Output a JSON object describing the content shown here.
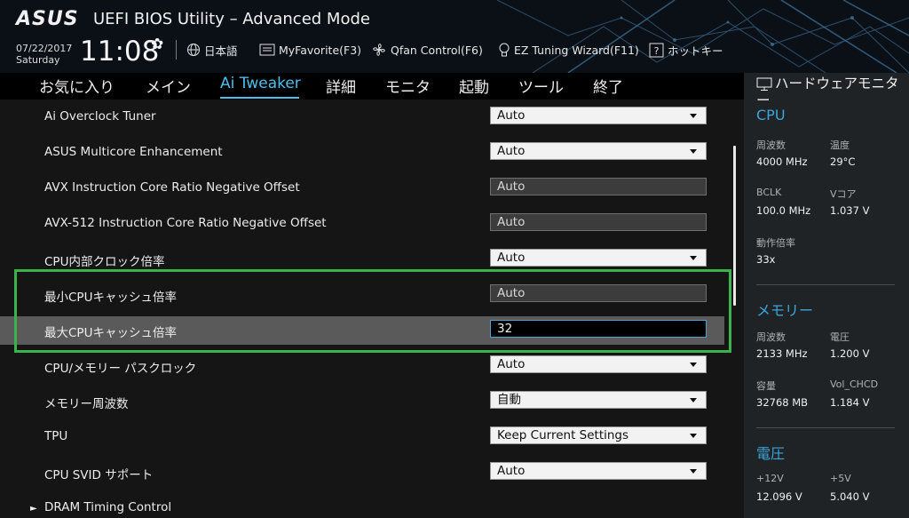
{
  "header": {
    "brand": "ASUS",
    "title": "UEFI BIOS Utility – Advanced Mode",
    "date": "07/22/2017",
    "day": "Saturday",
    "time": "11:08",
    "tools": [
      {
        "label": "日本語",
        "icon": "globe-icon"
      },
      {
        "label": "MyFavorite(F3)",
        "icon": "favorite-list-icon"
      },
      {
        "label": "Qfan Control(F6)",
        "icon": "fan-icon"
      },
      {
        "label": "EZ Tuning Wizard(F11)",
        "icon": "lightbulb-icon"
      },
      {
        "label": "ホットキー",
        "icon": "question-icon"
      }
    ]
  },
  "menu": {
    "items": [
      "お気に入り",
      "メイン",
      "Ai Tweaker",
      "詳細",
      "モニタ",
      "起動",
      "ツール",
      "終了"
    ],
    "active": "Ai Tweaker"
  },
  "settings": [
    {
      "label": "Ai Overclock Tuner",
      "value": "Auto",
      "type": "dropdown"
    },
    {
      "label": "ASUS Multicore Enhancement",
      "value": "Auto",
      "type": "dropdown"
    },
    {
      "label": "AVX Instruction Core Ratio Negative Offset",
      "value": "Auto",
      "type": "readonly"
    },
    {
      "label": "AVX-512 Instruction Core Ratio Negative Offset",
      "value": "Auto",
      "type": "readonly"
    },
    {
      "label": "CPU内部クロック倍率",
      "value": "Auto",
      "type": "dropdown"
    },
    {
      "label": "最小CPUキャッシュ倍率",
      "value": "Auto",
      "type": "readonly"
    },
    {
      "label": "最大CPUキャッシュ倍率",
      "value": "32",
      "type": "input",
      "selected": true
    },
    {
      "label": "CPU/メモリー パスクロック",
      "value": "Auto",
      "type": "dropdown"
    },
    {
      "label": "メモリー周波数",
      "value": "自動",
      "type": "dropdown"
    },
    {
      "label": "TPU",
      "value": "Keep Current Settings",
      "type": "dropdown"
    },
    {
      "label": "CPU SVID サポート",
      "value": "Auto",
      "type": "dropdown"
    }
  ],
  "submenu": "DRAM Timing Control",
  "hardware_monitor": {
    "title": "ハードウェアモニター",
    "cpu": {
      "heading": "CPU",
      "freq_label": "周波数",
      "freq": "4000 MHz",
      "temp_label": "温度",
      "temp": "29°C",
      "bclk_label": "BCLK",
      "bclk": "100.0 MHz",
      "vcore_label": "Vコア",
      "vcore": "1.037 V",
      "ratio_label": "動作倍率",
      "ratio": "33x"
    },
    "memory": {
      "heading": "メモリー",
      "freq_label": "周波数",
      "freq": "2133 MHz",
      "volt_label": "電圧",
      "volt": "1.200 V",
      "cap_label": "容量",
      "cap": "32768 MB",
      "vol_chcd_label": "Vol_CHCD",
      "vol_chcd": "1.184 V"
    },
    "voltage": {
      "heading": "電圧",
      "p12_label": "+12V",
      "p12": "12.096 V",
      "p5_label": "+5V",
      "p5": "5.040 V"
    }
  },
  "colors": {
    "accent": "#4ac0ee",
    "highlight_box": "#3ab44a",
    "panel_bg": "#151515",
    "selected_row": "#5a5a5a",
    "monitor_bg": "#202326"
  }
}
